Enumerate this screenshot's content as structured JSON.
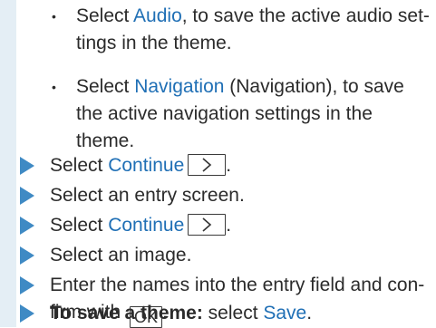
{
  "bullets": [
    {
      "pre": "",
      "link": "Audio",
      "post": ", to save the active audio set-",
      "line2": "tings in the theme."
    },
    {
      "pre": "",
      "link": "Navigation",
      "post": " (Navigation), to save",
      "line2": "the active navigation settings in the",
      "line3": "theme."
    }
  ],
  "select_word": "Select ",
  "bullet_glyph": "•",
  "continue_label": "Continue",
  "period": ".",
  "steps": {
    "entry_screen": "Select an entry screen.",
    "image": "Select an image.",
    "enter_names_line1": "Enter the names into the entry field and con-",
    "enter_names_line2": "firm with ",
    "ok_key": "OK",
    "save_bold": "To save a theme:",
    "save_pre": " select ",
    "save_link": "Save"
  },
  "colors": {
    "link": "#1f6fb5",
    "arrow": "#3f8ac4",
    "sidebar": "#e4eef5"
  },
  "icons": [
    "bullet-dot",
    "step-arrow-icon",
    "chevron-right-icon"
  ]
}
